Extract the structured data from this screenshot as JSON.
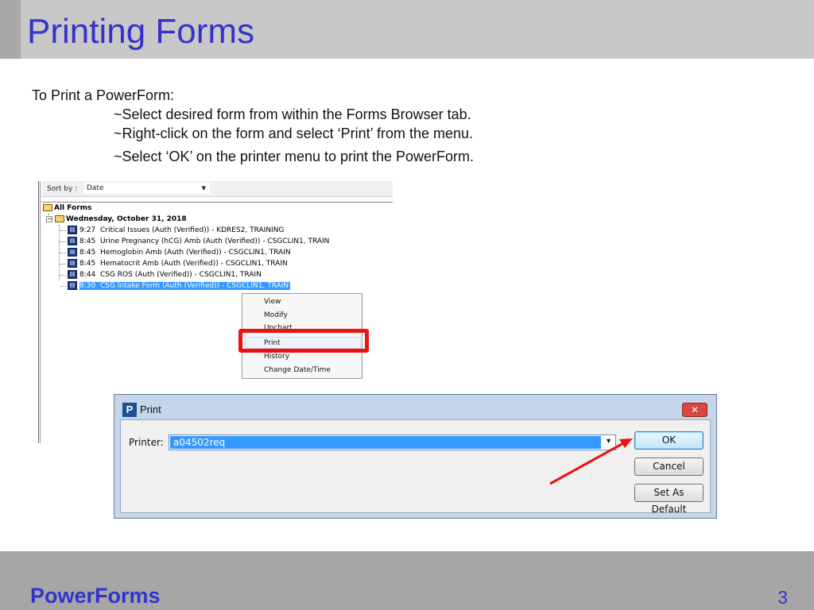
{
  "slide": {
    "title": "Printing Forms",
    "footer_title": "PowerForms",
    "page_number": "3"
  },
  "instructions": {
    "heading": "To Print a PowerForm:",
    "steps": [
      "~Select desired form from within the Forms Browser tab.",
      "~Right-click on the form and select ‘Print’ from the menu.",
      "~Select ‘OK’ on the printer menu to print the PowerForm."
    ]
  },
  "forms_browser": {
    "sort_label": "Sort by :",
    "sort_value": "Date",
    "root": "All Forms",
    "date_group": "Wednesday, October 31, 2018",
    "forms": [
      {
        "time": "9:27",
        "text": "Critical Issues (Auth (Verified)) - KDRES2, TRAINING"
      },
      {
        "time": "8:45",
        "text": "Urine Pregnancy (hCG) Amb (Auth (Verified)) - CSGCLIN1, TRAIN"
      },
      {
        "time": "8:45",
        "text": "Hemoglobin Amb (Auth (Verified)) - CSGCLIN1, TRAIN"
      },
      {
        "time": "8:45",
        "text": "Hematocrit Amb (Auth (Verified)) - CSGCLIN1, TRAIN"
      },
      {
        "time": "8:44",
        "text": "CSG ROS (Auth (Verified)) - CSGCLIN1, TRAIN"
      },
      {
        "time": "8:30",
        "text": "CSG Intake Form (Auth (Verified)) - CSGCLIN1, TRAIN"
      }
    ]
  },
  "context_menu": {
    "items": [
      "View",
      "Modify",
      "Unchart",
      "Print",
      "History",
      "Change Date/Time"
    ]
  },
  "print_dialog": {
    "title": "Print",
    "printer_label": "Printer:",
    "printer_value": "a04502req",
    "ok_label": "OK",
    "cancel_label": "Cancel",
    "default_label": "Set As Default"
  },
  "colors": {
    "title_blue": "#3333cc",
    "highlight_red": "#ee1111",
    "selection_blue": "#3399ff"
  }
}
